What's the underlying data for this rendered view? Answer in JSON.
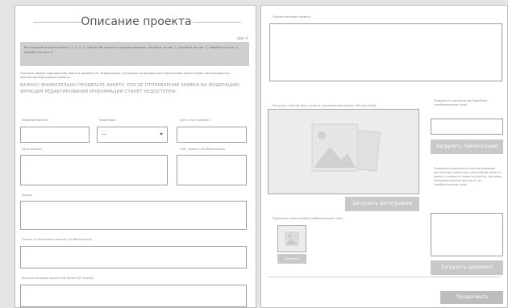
{
  "left": {
    "title": "Описание проекта",
    "step": "Шаг 4",
    "notice": "Вы заполнили шаги анкеты: 1, 2, 3, 4. Сейчас Вы можете отредактировать: перейти на шаг 1, перейти на шаг 2, перейти на шаг 3, перейти на шаг 4",
    "info": "Опишите проект максимально полно и развернуто. Информация, указанная на данном шаге заполнения анкеты будет использоваться для экспертной оценки проекта.",
    "warning": "ВАЖНО! ВНИМАТЕЛЬНО ПРОВЕРЬТЕ АНКЕТУ. ПОСЛЕ ОТПРАВЛЕНИЯ ЗАЯВКИ НА МОДЕРАЦИЮ ФУНКЦИЯ РЕДАКТИРОВАНИЯ ИНФОРМАЦИИ СТАНЕТ НЕДОСТУПНА.",
    "fields": {
      "name_label": "Название проекта",
      "nomination_label": "Номинация",
      "start_date_label": "Дата старта проекта",
      "goal_label": "Цель проекта",
      "site_label": "Сайт проекта (не обязательно)",
      "tasks_label": "Задачи",
      "links_label": "Ссылки на материалы проекта (не обязательно)",
      "short_desc_label": "Краткое описание проекта (не более 250 знаков)"
    }
  },
  "right": {
    "full_desc_label": "Полное описание проекта",
    "main_photo_label": "Загрузить главное фото проекта (минимальная ширина 560 пикселей)",
    "upload_photo_button": "Загрузить фотографию",
    "presentation_label": "Прикрепить презентацию PowerPoint (необязательное поле)",
    "upload_presentation_button": "Загрузить презентацию",
    "documents_label": "Прикрепить документы подтверждающие достижение (аналитики, реализацию проекта, сроки и стоимость проекта (гранты), дипломы, благодарственные письма и т.д.) (необязательное поле)",
    "upload_document_button": "Загрузить документ",
    "attach_photos_label": "Прикрепить фотографии (необязательное поле)",
    "thumb_button": "Загрузить",
    "continue_button": "Продолжить"
  }
}
